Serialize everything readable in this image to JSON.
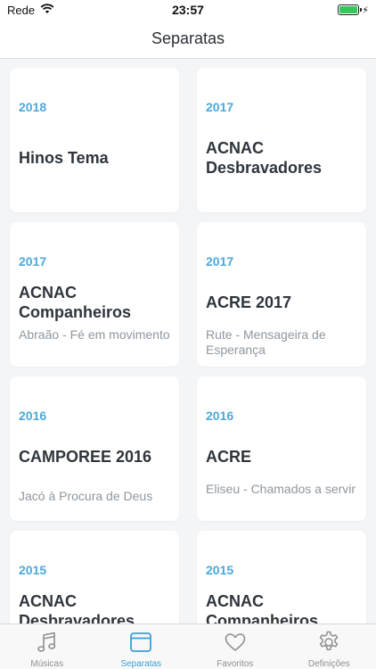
{
  "status": {
    "carrier": "Rede",
    "time": "23:57"
  },
  "nav": {
    "title": "Separatas"
  },
  "cards": [
    {
      "year": "2018",
      "title": "Hinos Tema",
      "subtitle": ""
    },
    {
      "year": "2017",
      "title": "ACNAC Desbravadores",
      "subtitle": ""
    },
    {
      "year": "2017",
      "title": "ACNAC Companheiros",
      "subtitle": "Abraão - Fé em movimento"
    },
    {
      "year": "2017",
      "title": "ACRE 2017",
      "subtitle": "Rute - Mensageira de Esperança"
    },
    {
      "year": "2016",
      "title": "CAMPOREE 2016",
      "subtitle": "Jacó à Procura de Deus"
    },
    {
      "year": "2016",
      "title": "ACRE",
      "subtitle": "Eliseu - Chamados a servir"
    },
    {
      "year": "2015",
      "title": "ACNAC Desbravadores",
      "subtitle": ""
    },
    {
      "year": "2015",
      "title": "ACNAC Companheiros",
      "subtitle": ""
    }
  ],
  "tabs": [
    {
      "label": "Músicas",
      "icon": "music-note-icon",
      "active": false
    },
    {
      "label": "Separatas",
      "icon": "browser-window-icon",
      "active": true
    },
    {
      "label": "Favoritos",
      "icon": "heart-icon",
      "active": false
    },
    {
      "label": "Definições",
      "icon": "gear-icon",
      "active": false
    }
  ],
  "colors": {
    "accent": "#4ca8dc",
    "battery": "#35c759"
  }
}
